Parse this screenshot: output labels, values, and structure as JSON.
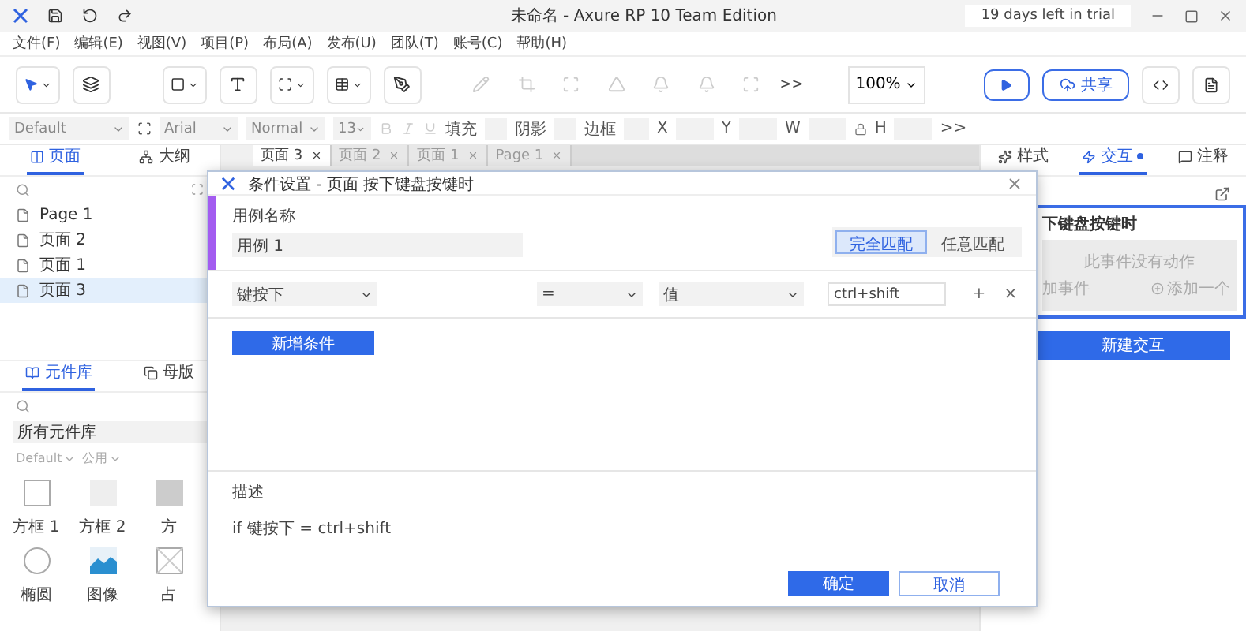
{
  "window": {
    "title": "未命名 - Axure RP 10 Team Edition",
    "trial_badge": "19 days left in trial"
  },
  "menu": [
    "文件(F)",
    "编辑(E)",
    "视图(V)",
    "项目(P)",
    "布局(A)",
    "发布(U)",
    "团队(T)",
    "账号(C)",
    "帮助(H)"
  ],
  "toolbar": {
    "overflow": ">>",
    "zoom": "100%",
    "share": "共享"
  },
  "format_bar": {
    "style": "Default",
    "font": "Arial",
    "weight": "Normal",
    "size": "13",
    "fill_label": "填充",
    "shadow_label": "阴影",
    "border_label": "边框",
    "x_label": "X",
    "y_label": "Y",
    "w_label": "W",
    "h_label": "H",
    "overflow": ">>"
  },
  "pages_panel": {
    "tabs": [
      {
        "label": "页面",
        "selected": true
      },
      {
        "label": "大纲",
        "selected": false
      }
    ],
    "pages": [
      {
        "label": "Page 1",
        "selected": false
      },
      {
        "label": "页面 2",
        "selected": false
      },
      {
        "label": "页面 1",
        "selected": false
      },
      {
        "label": "页面 3",
        "selected": true
      }
    ]
  },
  "library_panel": {
    "tabs": [
      {
        "label": "元件库",
        "selected": true
      },
      {
        "label": "母版",
        "selected": false
      }
    ],
    "library": "所有元件库",
    "filters": [
      "Default",
      "公用"
    ],
    "widgets": [
      {
        "label": "方框 1",
        "kind": "box"
      },
      {
        "label": "方框 2",
        "kind": "filled-box"
      },
      {
        "label": "方",
        "kind": "dark-box"
      },
      {
        "label": "椭圆",
        "kind": "circle"
      },
      {
        "label": "图像",
        "kind": "image"
      },
      {
        "label": "占",
        "kind": "placeholder"
      }
    ]
  },
  "canvas_tabs": [
    {
      "label": "页面 3",
      "selected": true
    },
    {
      "label": "页面 2",
      "selected": false
    },
    {
      "label": "页面 1",
      "selected": false
    },
    {
      "label": "Page 1",
      "selected": false
    }
  ],
  "right_panel": {
    "tabs": [
      {
        "label": "样式",
        "selected": false
      },
      {
        "label": "交互",
        "selected": true
      },
      {
        "label": "注释",
        "selected": false
      }
    ],
    "event_title": "下键盘按键时",
    "empty_note": "此事件没有动作",
    "add_event": "加事件",
    "add_action": "添加一个",
    "new_interaction": "新建交互"
  },
  "dialog": {
    "title": "条件设置 - 页面 按下键盘按键时",
    "name_label": "用例名称",
    "name_value": "用例 1",
    "match": [
      {
        "label": "完全匹配",
        "selected": true
      },
      {
        "label": "任意匹配",
        "selected": false
      }
    ],
    "condition": {
      "subject": "键按下",
      "operator": "=",
      "value_type": "值",
      "value": "ctrl+shift",
      "add": "+",
      "remove": "×"
    },
    "add_condition": "新增条件",
    "description_label": "描述",
    "description": "if 键按下 = ctrl+shift",
    "ok": "确定",
    "cancel": "取消"
  }
}
